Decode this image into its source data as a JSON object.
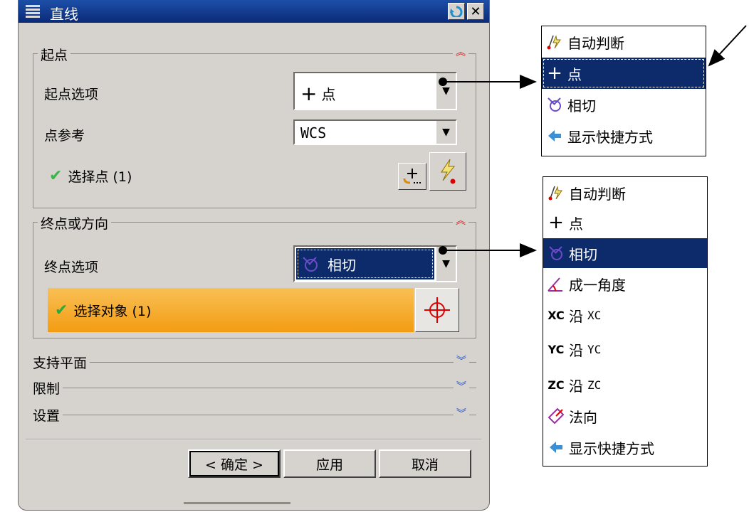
{
  "dialog": {
    "title": "直线",
    "start_group": {
      "title": "起点",
      "option_label": "起点选项",
      "option_value": "点",
      "ref_label": "点参考",
      "ref_value": "WCS",
      "select_label": "选择点 (1)"
    },
    "end_group": {
      "title": "终点或方向",
      "option_label": "终点选项",
      "option_value": "相切",
      "select_label": "选择对象 (1)"
    },
    "collapsed_groups": [
      "支持平面",
      "限制",
      "设置"
    ],
    "buttons": {
      "ok": "< 确定 >",
      "apply": "应用",
      "cancel": "取消"
    }
  },
  "menu_start": {
    "items": [
      "自动判断",
      "点",
      "相切",
      "显示快捷方式"
    ],
    "selected": "点"
  },
  "menu_end": {
    "items": [
      "自动判断",
      "点",
      "相切",
      "成一角度",
      "沿",
      "沿",
      "沿",
      "法向",
      "显示快捷方式"
    ],
    "axis_prefix": [
      "XC",
      "YC",
      "ZC"
    ],
    "axis_suffix": [
      "XC",
      "YC",
      "ZC"
    ],
    "selected": "相切"
  },
  "colors": {
    "title_bar": "#0b2a78",
    "selection_highlight": "#0d2a6b",
    "active_row": "#f6a623",
    "check_green": "#39b54a"
  }
}
